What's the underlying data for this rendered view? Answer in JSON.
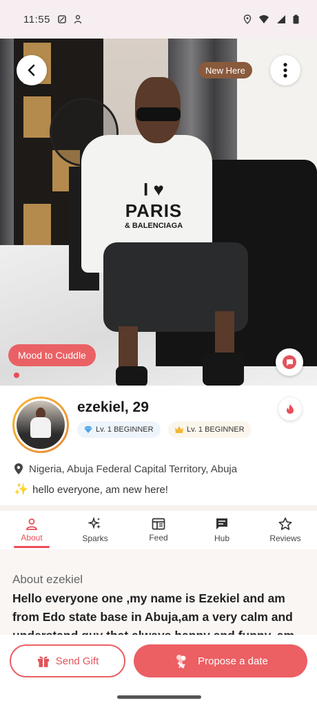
{
  "status_bar": {
    "time": "11:55"
  },
  "hero": {
    "new_badge": "New Here",
    "mood_badge": "Mood to Cuddle",
    "shirt": {
      "line1": "I ♥",
      "line2": "PARIS",
      "line3": "& BALENCIAGA"
    }
  },
  "profile": {
    "name": "ezekiel, 29",
    "levels": [
      {
        "icon": "diamond-icon",
        "label": "Lv. 1 BEGINNER"
      },
      {
        "icon": "crown-icon",
        "label": "Lv. 1 BEGINNER"
      }
    ],
    "location": "Nigeria, Abuja Federal Capital Territory, Abuja",
    "bio": "hello everyone, am new here!"
  },
  "tabs": [
    {
      "label": "About",
      "icon": "person-icon",
      "active": true
    },
    {
      "label": "Sparks",
      "icon": "sparkle-icon",
      "active": false
    },
    {
      "label": "Feed",
      "icon": "feed-icon",
      "active": false
    },
    {
      "label": "Hub",
      "icon": "chat-icon",
      "active": false
    },
    {
      "label": "Reviews",
      "icon": "star-icon",
      "active": false
    }
  ],
  "about": {
    "title": "About ezekiel",
    "body": "Hello everyone one ,my name is Ezekiel and am from Edo state base in Abuja,am a very calm and understand guy that always happy and funny, am"
  },
  "actions": {
    "gift_label": "Send Gift",
    "date_label": "Propose a date"
  },
  "colors": {
    "accent": "#ea4d55",
    "mood": "#ea6165",
    "new_badge": "#8a5a3c"
  }
}
